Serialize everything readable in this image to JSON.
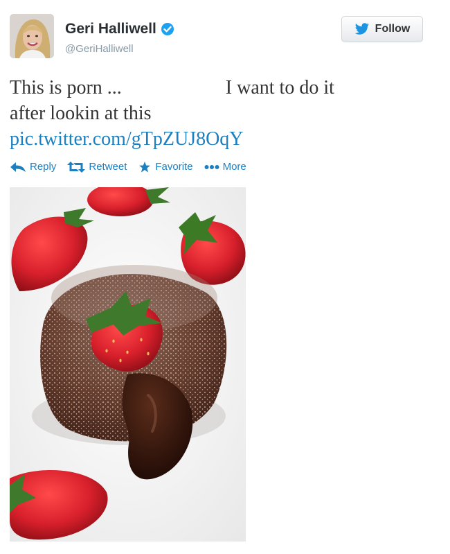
{
  "user": {
    "name": "Geri Halliwell",
    "handle": "@GeriHalliwell",
    "verified": true
  },
  "follow_button": {
    "label": "Follow"
  },
  "tweet": {
    "line1_part1": "This is porn ...",
    "line1_part2": "I want to do it",
    "line2": "after lookin at this",
    "link": "pic.twitter.com/gTpZUJ8OqY"
  },
  "actions": [
    {
      "label": "Reply",
      "icon": "reply-icon"
    },
    {
      "label": "Retweet",
      "icon": "retweet-icon"
    },
    {
      "label": "Favorite",
      "icon": "star-icon"
    },
    {
      "label": "More",
      "icon": "more-icon"
    }
  ],
  "colors": {
    "link": "#1c7fc0",
    "verified": "#1da1f2",
    "strawberry": "#d8202c",
    "cake": "#5a3020",
    "chocolate": "#2a120a"
  }
}
